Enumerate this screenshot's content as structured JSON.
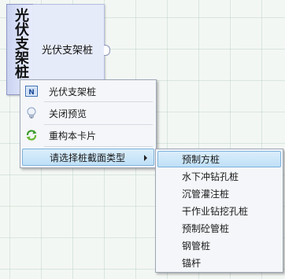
{
  "node": {
    "title": "光伏支架桩",
    "port_label": "光伏支架桩"
  },
  "context_menu": {
    "items": [
      {
        "label": "光伏支架桩",
        "icon": "node-n-icon"
      },
      {
        "label": "关闭预览",
        "icon": "lightbulb-icon"
      },
      {
        "label": "重构本卡片",
        "icon": "refresh-arrows-icon"
      },
      {
        "label": "请选择桩截面类型",
        "icon": "",
        "has_submenu": true,
        "selected": true
      }
    ]
  },
  "submenu": {
    "items": [
      {
        "label": "预制方桩",
        "selected": true
      },
      {
        "label": "水下冲钻孔桩"
      },
      {
        "label": "沉管灌注桩"
      },
      {
        "label": "干作业钻挖孔桩"
      },
      {
        "label": "预制砼管桩"
      },
      {
        "label": "钢管桩"
      },
      {
        "label": "锚杆"
      }
    ]
  },
  "colors": {
    "highlight": "#bfe0f7",
    "highlight_border": "#7db2dc",
    "node_body": "#e6ebfa",
    "canvas": "#f3f7f4"
  }
}
